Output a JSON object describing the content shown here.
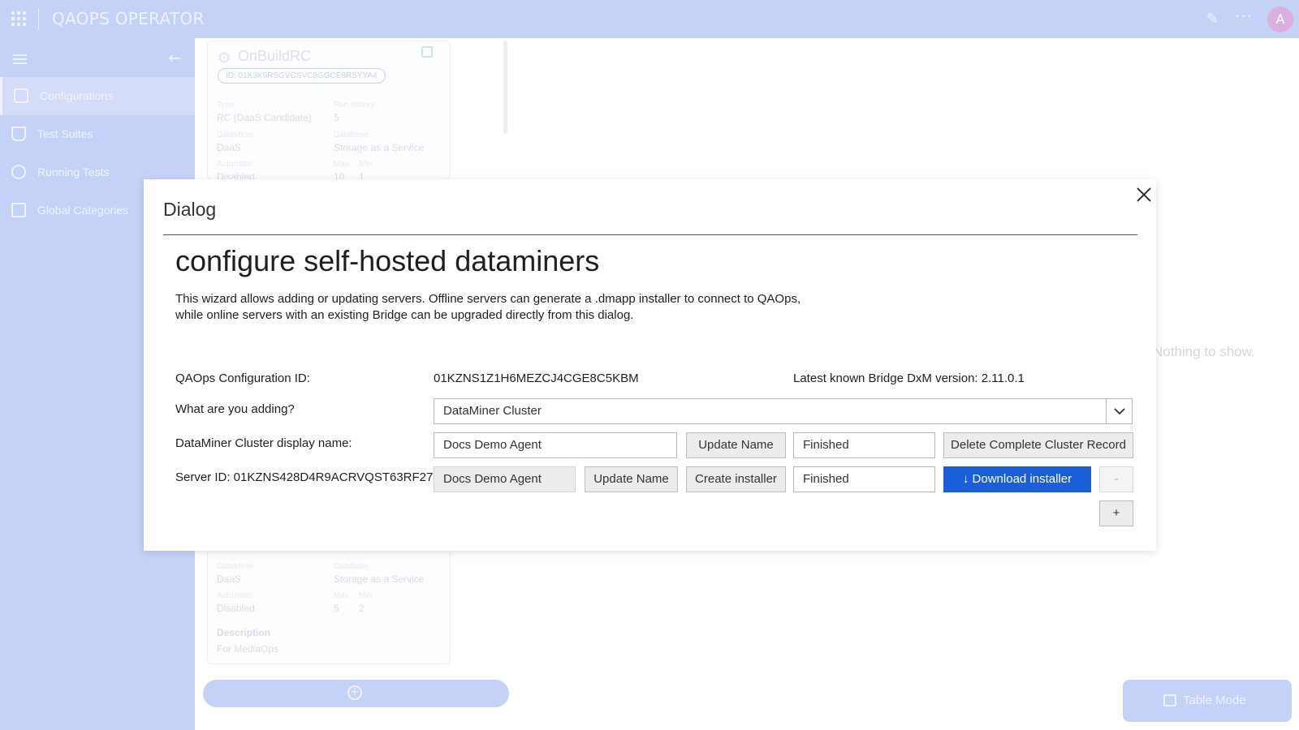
{
  "app": {
    "title": "QAOPS OPERATOR",
    "avatar_letter": "A"
  },
  "sidebar": {
    "items": [
      {
        "label": "Configurations",
        "icon": "layout-icon",
        "active": true
      },
      {
        "label": "Test Suites",
        "icon": "flask-icon",
        "active": false
      },
      {
        "label": "Running Tests",
        "icon": "running-icon",
        "active": false
      },
      {
        "label": "Global Categories",
        "icon": "categories-icon",
        "active": false
      }
    ]
  },
  "card": {
    "name": "OnBuildRC",
    "id": "ID: 01K3K9RSGVCSVC8GGCE8RSYYA4",
    "type_label": "Type",
    "type_value": "RC (DaaS Candidate)",
    "run_history_label": "Run history",
    "run_history_value": "5",
    "dataminer_label": "DataMiner",
    "dataminer_value": "DaaS",
    "database_label": "Database",
    "database_value": "Storage as a Service",
    "automatic_label": "Automatic",
    "automatic_value": "Disabled",
    "max_label": "Max",
    "max_value": "10",
    "min_label": "Min",
    "min_value": "1"
  },
  "card2": {
    "dataminer_label": "DataMiner",
    "dataminer_value": "DaaS",
    "database_label": "Database",
    "database_value": "Storage as a Service",
    "automatic_label": "Automatic",
    "automatic_value": "Disabled",
    "max_label": "Max",
    "max_value": "5",
    "min_label": "Min",
    "min_value": "2",
    "description_label": "Description",
    "description_value": "For MediaOps"
  },
  "empty_text": "Nothing to show.",
  "table_mode_label": "Table Mode",
  "dialog": {
    "title": "Dialog",
    "heading": "configure self-hosted dataminers",
    "description": "This wizard allows adding or updating servers. Offline servers can generate a .dmapp installer to connect to QAOps, while online servers with an existing Bridge can be upgraded directly from this dialog.",
    "config_id_label": "QAOps Configuration ID:",
    "config_id_value": "01KZNS1Z1H6MEZCJ4CGE8C5KBM",
    "bridge_version": "Latest known Bridge DxM version: 2.11.0.1",
    "adding_label": "What are you adding?",
    "adding_value": "DataMiner Cluster",
    "cluster_name_label": "DataMiner Cluster display name:",
    "cluster_name_value": "Docs Demo Agent",
    "update_name_label": "Update Name",
    "cluster_status": "Finished",
    "delete_cluster_label": "Delete Complete Cluster Record",
    "server_label": "Server ID: 01KZNS428D4R9ACRVQST63RF27",
    "server_name_value": "Docs Demo Agent",
    "server_update_label": "Update Name",
    "create_installer_label": "Create installer",
    "server_status": "Finished",
    "download_installer_label": "↓ Download installer",
    "remove_label": "-",
    "add_label": "+",
    "primary_color": "#1a5ed8",
    "rule_color": "#1a5eb8"
  }
}
